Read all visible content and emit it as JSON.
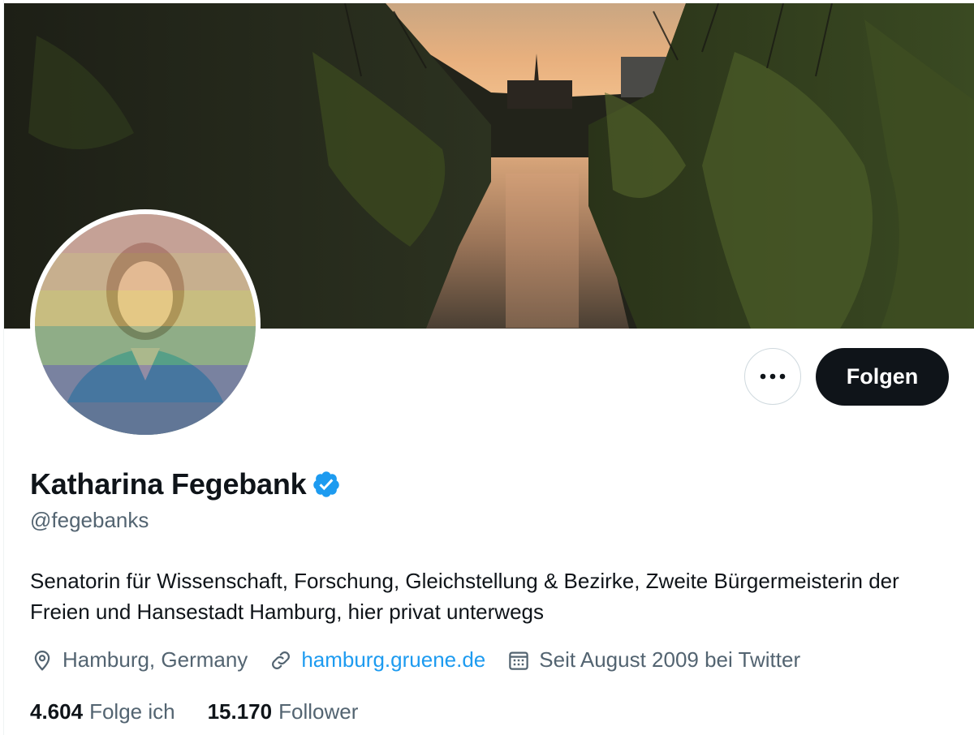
{
  "profile": {
    "display_name": "Katharina Fegebank",
    "handle": "@fegebanks",
    "bio": "Senatorin für Wissenschaft, Forschung, Gleichstellung & Bezirke, Zweite Bürgermeisterin der Freien und Hansestadt Hamburg, hier privat unterwegs",
    "verified": true
  },
  "actions": {
    "follow_label": "Folgen"
  },
  "meta": {
    "location": "Hamburg, Germany",
    "website": "hamburg.gruene.de",
    "joined": "Seit August 2009 bei Twitter"
  },
  "stats": {
    "following_count": "4.604",
    "following_label": "Folge ich",
    "followers_count": "15.170",
    "followers_label": "Follower"
  },
  "colors": {
    "accent": "#1d9bf0",
    "follow_button_bg": "#0f1419",
    "secondary_text": "#536471",
    "verified_badge": "#1d9bf0"
  },
  "icons": {
    "more": "more-horizontal-icon",
    "verified": "verified-badge-icon",
    "location": "location-pin-icon",
    "link": "link-icon",
    "calendar": "calendar-icon"
  }
}
